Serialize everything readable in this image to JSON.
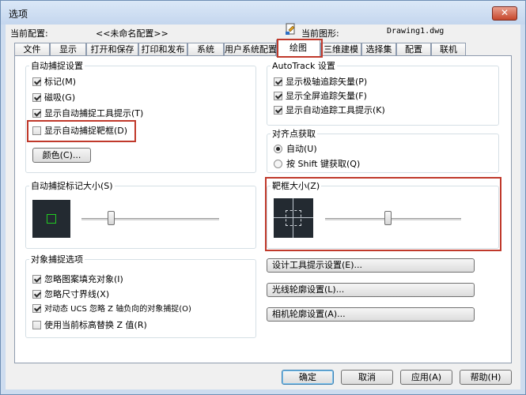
{
  "window": {
    "title": "选项",
    "close_glyph": "✕"
  },
  "header": {
    "profile_label": "当前配置:",
    "profile_value": "<<未命名配置>>",
    "drawing_label": "当前图形:",
    "drawing_value": "Drawing1.dwg"
  },
  "tabs": [
    "文件",
    "显示",
    "打开和保存",
    "打印和发布",
    "系统",
    "用户系统配置",
    "绘图",
    "三维建模",
    "选择集",
    "配置",
    "联机"
  ],
  "active_tab": "绘图",
  "autosnap": {
    "legend": "自动捕捉设置",
    "items": [
      {
        "label": "标记(M)",
        "checked": true
      },
      {
        "label": "磁吸(G)",
        "checked": true
      },
      {
        "label": "显示自动捕捉工具提示(T)",
        "checked": true
      },
      {
        "label": "显示自动捕捉靶框(D)",
        "checked": false
      }
    ],
    "color_button": "颜色(C)..."
  },
  "marker_size": {
    "legend": "自动捕捉标记大小(S)",
    "level": 0.2
  },
  "osnap_options": {
    "legend": "对象捕捉选项",
    "items": [
      {
        "label": "忽略图案填充对象(I)",
        "checked": true
      },
      {
        "label": "忽略尺寸界线(X)",
        "checked": true
      },
      {
        "label": "对动态 UCS 忽略 Z 轴负向的对象捕捉(O)",
        "checked": true
      },
      {
        "label": "使用当前标高替换 Z 值(R)",
        "checked": false
      }
    ]
  },
  "autotrack": {
    "legend": "AutoTrack 设置",
    "items": [
      {
        "label": "显示极轴追踪矢量(P)",
        "checked": true
      },
      {
        "label": "显示全屏追踪矢量(F)",
        "checked": true
      },
      {
        "label": "显示自动追踪工具提示(K)",
        "checked": true
      }
    ]
  },
  "alignment": {
    "legend": "对齐点获取",
    "options": [
      {
        "label": "自动(U)",
        "selected": true
      },
      {
        "label": "按 Shift 键获取(Q)",
        "selected": false
      }
    ]
  },
  "aperture": {
    "legend": "靶框大小(Z)",
    "level": 0.46
  },
  "buttons": {
    "design_tooltip": "设计工具提示设置(E)...",
    "light_glyph": "光线轮廓设置(L)...",
    "camera_glyph": "相机轮廓设置(A)..."
  },
  "footer": {
    "ok": "确定",
    "cancel": "取消",
    "apply": "应用(A)",
    "help": "帮助(H)"
  },
  "colors": {
    "highlight": "#c0392b",
    "marker": "#22cc22",
    "preview_bg": "#232a31"
  }
}
